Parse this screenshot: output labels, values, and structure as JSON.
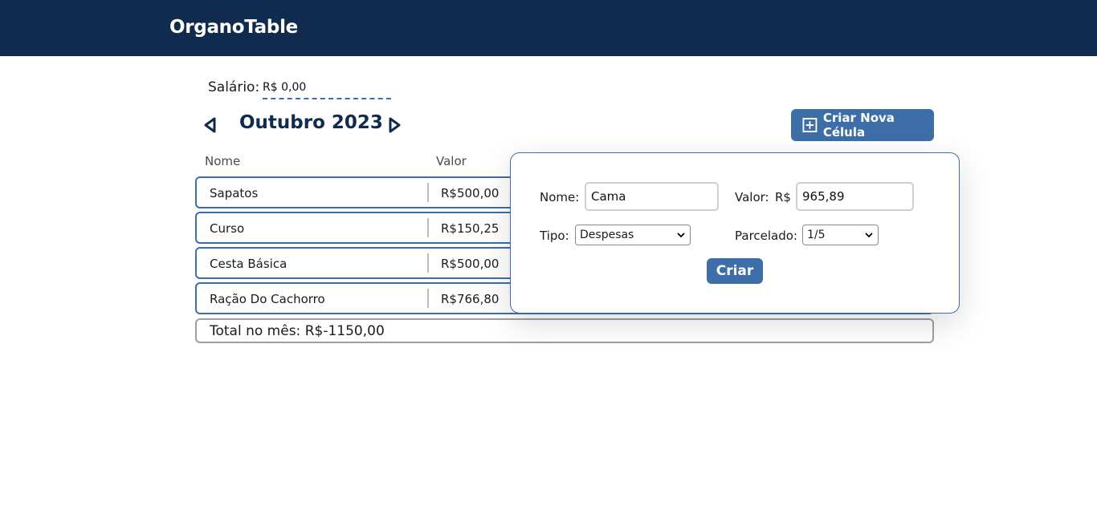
{
  "header": {
    "brand": "OrganoTable"
  },
  "salary": {
    "label": "Salário:",
    "value": "R$ 0,00"
  },
  "month_nav": {
    "title": "Outubro 2023"
  },
  "toolbar": {
    "create_label": "Criar Nova Célula"
  },
  "table": {
    "columns": [
      "Nome",
      "Valor"
    ],
    "rows": [
      {
        "name": "Sapatos",
        "value": "R$500,00"
      },
      {
        "name": "Curso",
        "value": "R$150,25"
      },
      {
        "name": "Cesta Básica",
        "value": "R$500,00"
      },
      {
        "name": "Ração Do Cachorro",
        "value": "R$766,80"
      }
    ],
    "total": "Total no mês: R$-1150,00"
  },
  "modal": {
    "nome_label": "Nome:",
    "nome_value": "Cama",
    "valor_label": "Valor:",
    "currency": "R$",
    "valor_value": "965,89",
    "tipo_label": "Tipo:",
    "tipo_selected": "Despesas",
    "parcelado_label": "Parcelado:",
    "parcelado_selected": "1/5",
    "submit_label": "Criar"
  },
  "colors": {
    "header_bg": "#112b4e",
    "accent": "#3d6ea8",
    "title": "#112b4e"
  },
  "icons": {
    "prev": "triangle-left-icon",
    "next": "triangle-right-icon",
    "add": "plus-square-icon",
    "chevron": "chevron-down-icon"
  }
}
